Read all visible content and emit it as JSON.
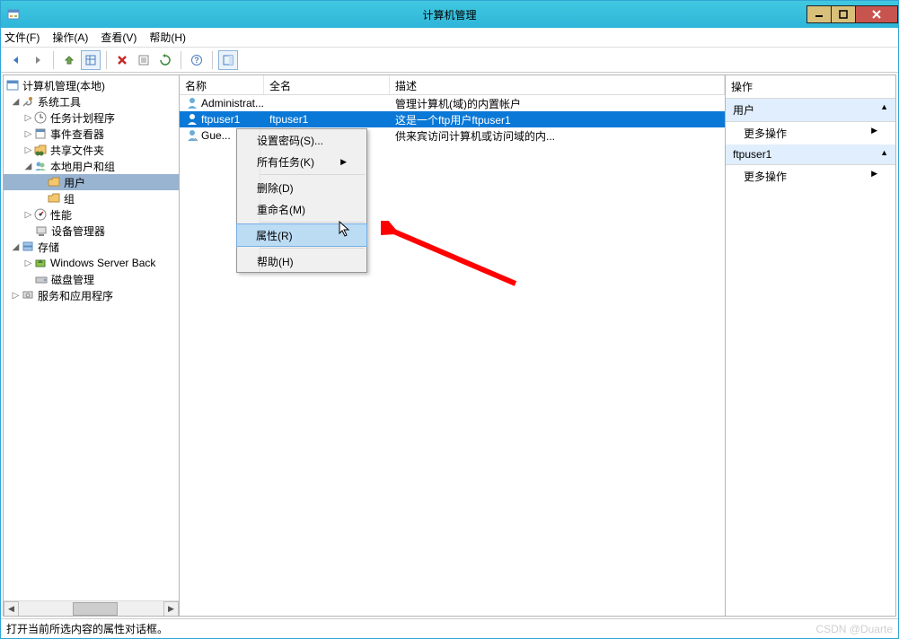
{
  "title": "计算机管理",
  "menu": {
    "file": "文件(F)",
    "action": "操作(A)",
    "view": "查看(V)",
    "help": "帮助(H)"
  },
  "tree": {
    "root": "计算机管理(本地)",
    "systools": "系统工具",
    "tasks": "任务计划程序",
    "events": "事件查看器",
    "shared": "共享文件夹",
    "localusers": "本地用户和组",
    "users": "用户",
    "groups": "组",
    "perf": "性能",
    "devmgr": "设备管理器",
    "storage": "存储",
    "wsb": "Windows Server Back",
    "diskmgr": "磁盘管理",
    "services": "服务和应用程序"
  },
  "list": {
    "col_name": "名称",
    "col_full": "全名",
    "col_desc": "描述",
    "rows": [
      {
        "name": "Administrat...",
        "full": "",
        "desc": "管理计算机(域)的内置帐户"
      },
      {
        "name": "ftpuser1",
        "full": "ftpuser1",
        "desc": "这是一个ftp用户ftpuser1"
      },
      {
        "name": "Gue...",
        "full": "",
        "desc": "供来宾访问计算机或访问域的内..."
      }
    ]
  },
  "context_menu": {
    "setpwd": "设置密码(S)...",
    "alltasks": "所有任务(K)",
    "delete": "删除(D)",
    "rename": "重命名(M)",
    "props": "属性(R)",
    "help": "帮助(H)"
  },
  "actions": {
    "title": "操作",
    "users_hdr": "用户",
    "more1": "更多操作",
    "sel_hdr": "ftpuser1",
    "more2": "更多操作"
  },
  "statusbar": "打开当前所选内容的属性对话框。",
  "watermark": "CSDN @Duarte"
}
